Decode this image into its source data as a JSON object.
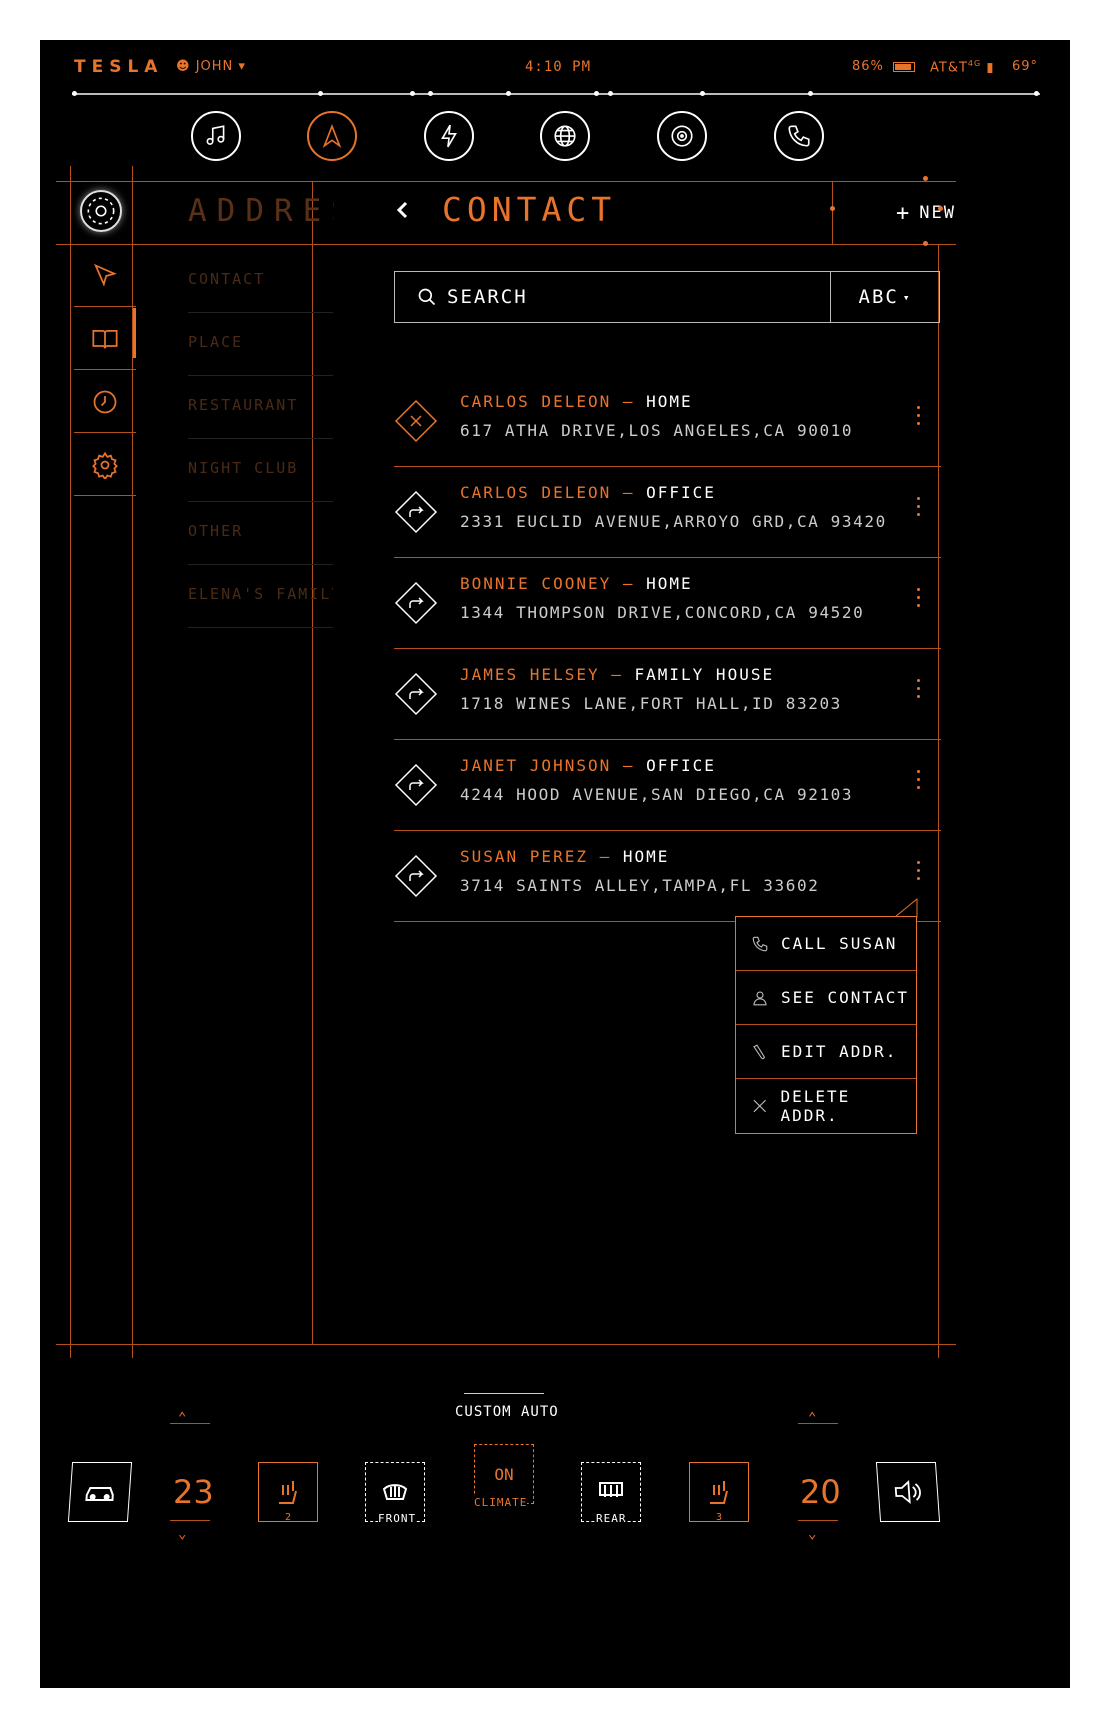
{
  "status": {
    "logo": "TESLA",
    "user": "JOHN",
    "time": "4:10 PM",
    "battery": "86%",
    "carrier": "AT&T",
    "network": "4G",
    "temperature": "69°"
  },
  "top_nav": [
    "music-icon",
    "navigation-icon",
    "charging-icon",
    "globe-icon",
    "disc-icon",
    "phone-icon"
  ],
  "sidebar": [
    "navigate-icon",
    "book-icon",
    "clock-icon",
    "settings-icon"
  ],
  "categories": {
    "title": "ADDRESS",
    "items": [
      "CONTACT",
      "PLACE",
      "RESTAURANT",
      "NIGHT CLUB",
      "OTHER",
      "ELENA'S FAMILY"
    ]
  },
  "main": {
    "title": "CONTACT",
    "new_label": "NEW",
    "search_placeholder": "SEARCH",
    "sort_label": "ABC"
  },
  "contacts": [
    {
      "name": "CARLOS DELEON",
      "kind": "HOME",
      "address": "617 ATHA DRIVE,LOS ANGELES,CA 90010"
    },
    {
      "name": "CARLOS DELEON",
      "kind": "OFFICE",
      "address": "2331 EUCLID AVENUE,ARROYO GRD,CA 93420"
    },
    {
      "name": "BONNIE COONEY",
      "kind": "HOME",
      "address": "1344 THOMPSON DRIVE,CONCORD,CA 94520"
    },
    {
      "name": "JAMES HELSEY",
      "kind": "FAMILY HOUSE",
      "address": "1718 WINES LANE,FORT HALL,ID 83203"
    },
    {
      "name": "JANET JOHNSON",
      "kind": "OFFICE",
      "address": "4244 HOOD AVENUE,SAN DIEGO,CA 92103"
    },
    {
      "name": "SUSAN PEREZ",
      "kind": "HOME",
      "address": "3714 SAINTS ALLEY,TAMPA,FL 33602"
    }
  ],
  "context_menu": [
    "CALL SUSAN",
    "SEE CONTACT",
    "EDIT ADDR.",
    "DELETE ADDR."
  ],
  "bottom": {
    "left_temp": "23",
    "right_temp": "20",
    "seat_left_level": "2",
    "seat_right_level": "3",
    "front_label": "FRONT",
    "rear_label": "REAR",
    "climate_mode": "CUSTOM AUTO",
    "climate_on": "ON",
    "climate_label": "CLIMATE"
  },
  "colors": {
    "accent": "#e8742c",
    "background": "#000000"
  }
}
